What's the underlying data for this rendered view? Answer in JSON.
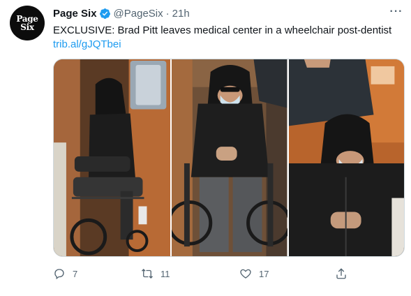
{
  "tweet": {
    "author": {
      "name": "Page Six",
      "handle": "@PageSix",
      "avatar_line1": "Page",
      "avatar_line2": "Six",
      "verified": true
    },
    "separator": "·",
    "time": "21h",
    "more_label": "···",
    "text": "EXCLUSIVE: Brad Pitt leaves medical center in a wheelchair post-dentist",
    "link": "trib.al/gJQTbei",
    "media": {
      "count": 3,
      "photos": [
        "wheelchair-side-view",
        "wheelchair-front-view",
        "wheelchair-closeup"
      ]
    },
    "stats": {
      "replies": "7",
      "retweets": "11",
      "likes": "17"
    },
    "icons": {
      "verified": "verified-badge-icon",
      "reply": "reply-icon",
      "retweet": "retweet-icon",
      "like": "heart-icon",
      "share": "share-icon",
      "more": "more-icon"
    },
    "colors": {
      "text": "#0f1419",
      "muted": "#536471",
      "link": "#1d9bf0",
      "verified": "#1d9bf0"
    }
  }
}
